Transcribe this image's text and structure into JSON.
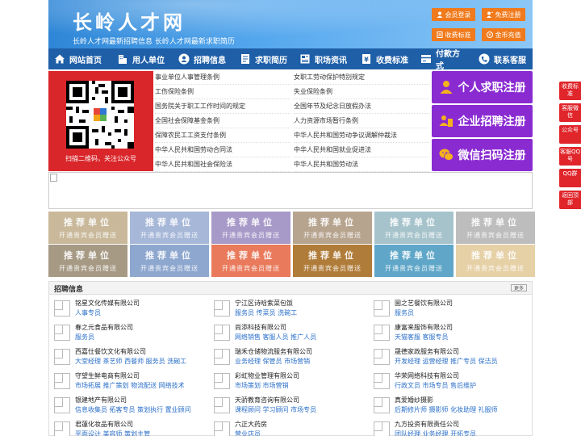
{
  "header": {
    "title": "长岭人才网",
    "subtitle": "长岭人才网最新招聘信息  长岭人才网最新求职简历",
    "buttons": [
      {
        "label": "会员登录",
        "icon": "user-icon"
      },
      {
        "label": "免费注册",
        "icon": "person-add-icon"
      },
      {
        "label": "收费标准",
        "icon": "doc-icon"
      },
      {
        "label": "金币充值",
        "icon": "coin-icon"
      }
    ]
  },
  "nav": [
    {
      "label": "网站首页",
      "icon": "home-icon"
    },
    {
      "label": "用人单位",
      "icon": "building-icon"
    },
    {
      "label": "招聘信息",
      "icon": "people-icon"
    },
    {
      "label": "求职简历",
      "icon": "resume-icon"
    },
    {
      "label": "职场资讯",
      "icon": "news-icon"
    },
    {
      "label": "收费标准",
      "icon": "fee-icon"
    },
    {
      "label": "付款方式",
      "icon": "payment-icon"
    },
    {
      "label": "联系客服",
      "icon": "phone-icon"
    }
  ],
  "qr": {
    "caption": "扫描二维码，关注公众号"
  },
  "laws": {
    "left": [
      "事业单位人事管理条例",
      "工伤保险条例",
      "国务院关于职工工作时间的规定",
      "全国社会保障基金条例",
      "保障农民工工资支付条例",
      "中华人民共和国劳动合同法",
      "中华人民共和国社会保险法"
    ],
    "right": [
      "女职工劳动保护特别规定",
      "失业保险条例",
      "全国年节及纪念日放假办法",
      "人力资源市场暂行条例",
      "中华人民共和国劳动争议调解仲裁法",
      "中华人民共和国就业促进法",
      "中华人民共和国劳动法"
    ]
  },
  "register": [
    {
      "label": "个人求职注册",
      "icon": "person-icon"
    },
    {
      "label": "企业招聘注册",
      "icon": "company-icon"
    },
    {
      "label": "微信扫码注册",
      "icon": "wechat-icon"
    }
  ],
  "ads": {
    "line1": "推荐单位",
    "line2": "开通贵宾会员赠送",
    "colors_row1": [
      "#c9b99a",
      "#a6b7d8",
      "#a79ac9",
      "#b7a48f",
      "#a6c3cc",
      "#bdbdbd"
    ],
    "colors_row2": [
      "#a79a85",
      "#8ea7cf",
      "#e97a5c",
      "#b07c3a",
      "#5fa6c8",
      "#e6d0a6"
    ]
  },
  "jobs": {
    "title": "招聘信息",
    "more": "更多",
    "items": [
      {
        "company": "铭星文化传媒有限公司",
        "positions": "人事专员"
      },
      {
        "company": "宁江区诗晗紫菜包饭",
        "positions": "服务员 传菜员 洗碗工"
      },
      {
        "company": "圌之艺餐饮有限公司",
        "positions": "服务员"
      },
      {
        "company": "春之元食品有限公司",
        "positions": "服务员"
      },
      {
        "company": "尚添科技有限公司",
        "positions": "网络销售 客服人员 推广人员"
      },
      {
        "company": "康富来服饰有限公司",
        "positions": "天猫客服 客服专员"
      },
      {
        "company": "西嘉仕餐饮文化有限公司",
        "positions": "大堂经理 茶艺师 西餐师 服务员 洗碗工"
      },
      {
        "company": "瑞禾仓储物流服务有限公司",
        "positions": "业务经理 保管员 市场营销"
      },
      {
        "company": "晟德家政服务有限公司",
        "positions": "开发经理 运营经理 推广专员 保洁员"
      },
      {
        "company": "守望生鲜电商有限公司",
        "positions": "市场拓展 推广策划 物流配送 网络技术"
      },
      {
        "company": "彩虹物业管理有限公司",
        "positions": "市场策划 市场营销"
      },
      {
        "company": "华荣网络科技有限公司",
        "positions": "行政文员 市场专员 售后维护"
      },
      {
        "company": "银建地产有限公司",
        "positions": "信息收集员 拓客专员 策划执行 置业顾问"
      },
      {
        "company": "天骄教育咨询有限公司",
        "positions": "课程顾问 学习顾问 市场专员"
      },
      {
        "company": "真爱婚纱摄影",
        "positions": "后期修片师 摄影师 化妆助理 礼服师"
      },
      {
        "company": "君蓮化妆品有限公司",
        "positions": "平面设计 美容师 策划主管"
      },
      {
        "company": "六正大药房",
        "positions": "营业店员"
      },
      {
        "company": "九方投资有限责任公司",
        "positions": "团队经理 业务经理 开拓专员"
      }
    ]
  },
  "float": [
    "收费标准",
    "客服微信",
    "公众号",
    "客服QQ号",
    "QQ群",
    "返回顶部"
  ]
}
